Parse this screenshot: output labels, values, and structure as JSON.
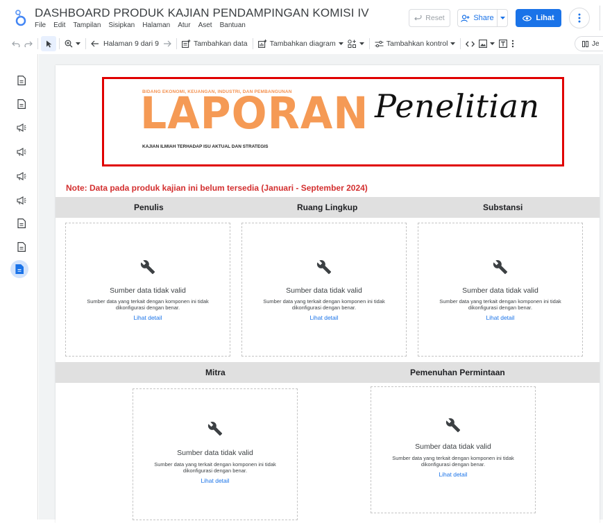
{
  "app": {
    "title": "DASHBOARD PRODUK KAJIAN PENDAMPINGAN KOMISI IV",
    "menu": [
      "File",
      "Edit",
      "Tampilan",
      "Sisipkan",
      "Halaman",
      "Atur",
      "Aset",
      "Bantuan"
    ],
    "reset_label": "Reset",
    "share_label": "Share",
    "view_label": "Lihat"
  },
  "toolbar": {
    "page_label": "Halaman 9 dari 9",
    "add_data_label": "Tambahkan data",
    "add_chart_label": "Tambahkan diagram",
    "add_control_label": "Tambahkan kontrol",
    "pill_label": "Je"
  },
  "rail": {
    "icons": [
      "page-icon",
      "page-icon",
      "megaphone-icon",
      "megaphone-icon",
      "megaphone-icon",
      "megaphone-icon",
      "page-icon",
      "page-icon",
      "page-icon-active"
    ]
  },
  "report": {
    "banner": {
      "top_text": "BIDANG EKONOMI, KEUANGAN, INDUSTRI, DAN PEMBANGUNAN",
      "big_text": "LAPORAN",
      "script_text": "Penelitian",
      "sub_text": "KAJIAN ILMIAH TERHADAP ISU AKTUAL DAN STRATEGIS"
    },
    "note": "Note: Data pada produk kajian ini belum tersedia (Januari - September 2024)",
    "section1": {
      "headers": [
        "Penulis",
        "Ruang Lingkup",
        "Substansi"
      ]
    },
    "section2": {
      "headers": [
        "Mitra",
        "Pemenuhan Permintaan"
      ]
    },
    "error_card": {
      "title": "Sumber data tidak valid",
      "desc": "Sumber data yang terkait dengan komponen ini tidak dikonfigurasi dengan benar.",
      "link": "Lihat detail"
    }
  },
  "colors": {
    "accent": "#1a73e8",
    "banner_border": "#e00000",
    "banner_orange": "#f59a55",
    "note_red": "#d32f2f"
  }
}
